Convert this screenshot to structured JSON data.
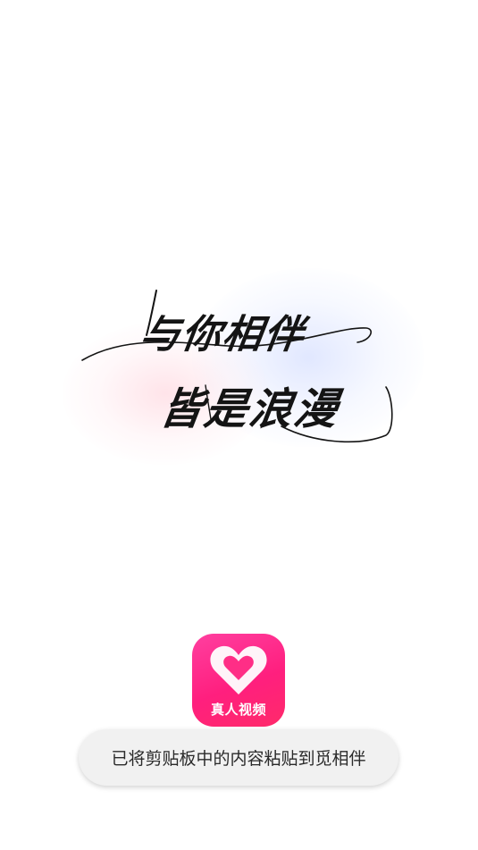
{
  "splash": {
    "slogan_line1": "与你相伴",
    "slogan_line2": "皆是浪漫"
  },
  "app_logo": {
    "caption": "真人视频",
    "icon": "heart-icon",
    "brand_color": "#ff2a7f"
  },
  "toast": {
    "message": "已将剪贴板中的内容粘贴到觅相伴"
  }
}
